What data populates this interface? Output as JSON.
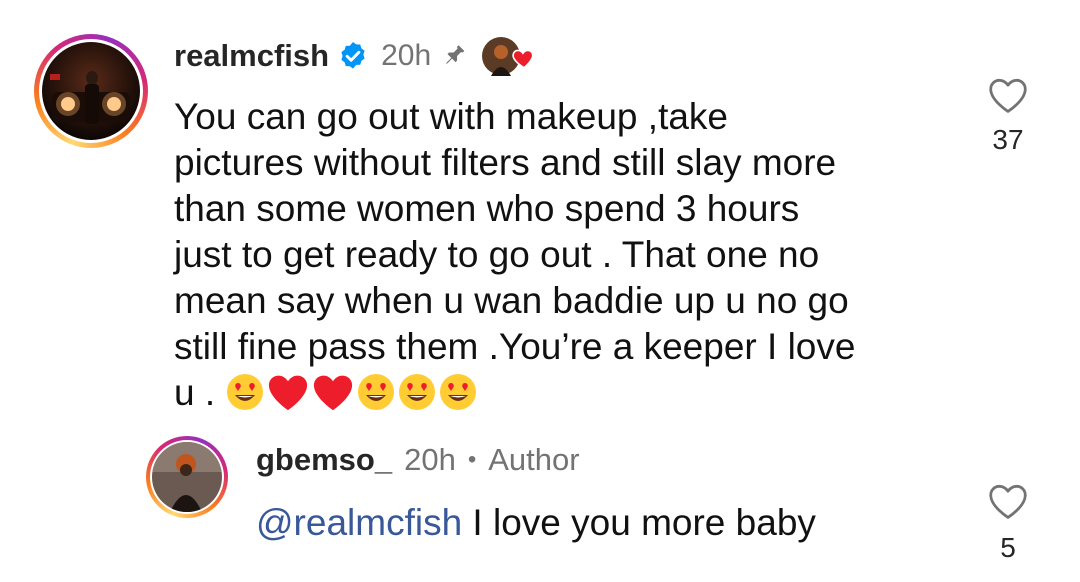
{
  "comment": {
    "username": "realmcfish",
    "verified": true,
    "time": "20h",
    "pinned": true,
    "liked_by_author": true,
    "lines": [
      "You can go out with makeup ,take",
      "pictures without filters and still slay more",
      "than some women who spend 3 hours",
      "just to get ready to go out . That one no",
      "mean say when u wan baddie up u no go",
      "still fine pass them .You’re a keeper I love",
      "u ."
    ],
    "emojis": [
      "heart-eyes",
      "red-heart",
      "red-heart",
      "heart-eyes",
      "heart-eyes",
      "heart-eyes"
    ],
    "like_count": "37"
  },
  "reply": {
    "username": "gbemso_",
    "time": "20h",
    "separator": "•",
    "badge": "Author",
    "mention": "@realmcfish",
    "text": " I love you more baby",
    "like_count": "5"
  },
  "colors": {
    "verified_badge": "#0095f6",
    "heart": "#ed1d2b",
    "mention": "#385898",
    "meta": "#737373"
  }
}
